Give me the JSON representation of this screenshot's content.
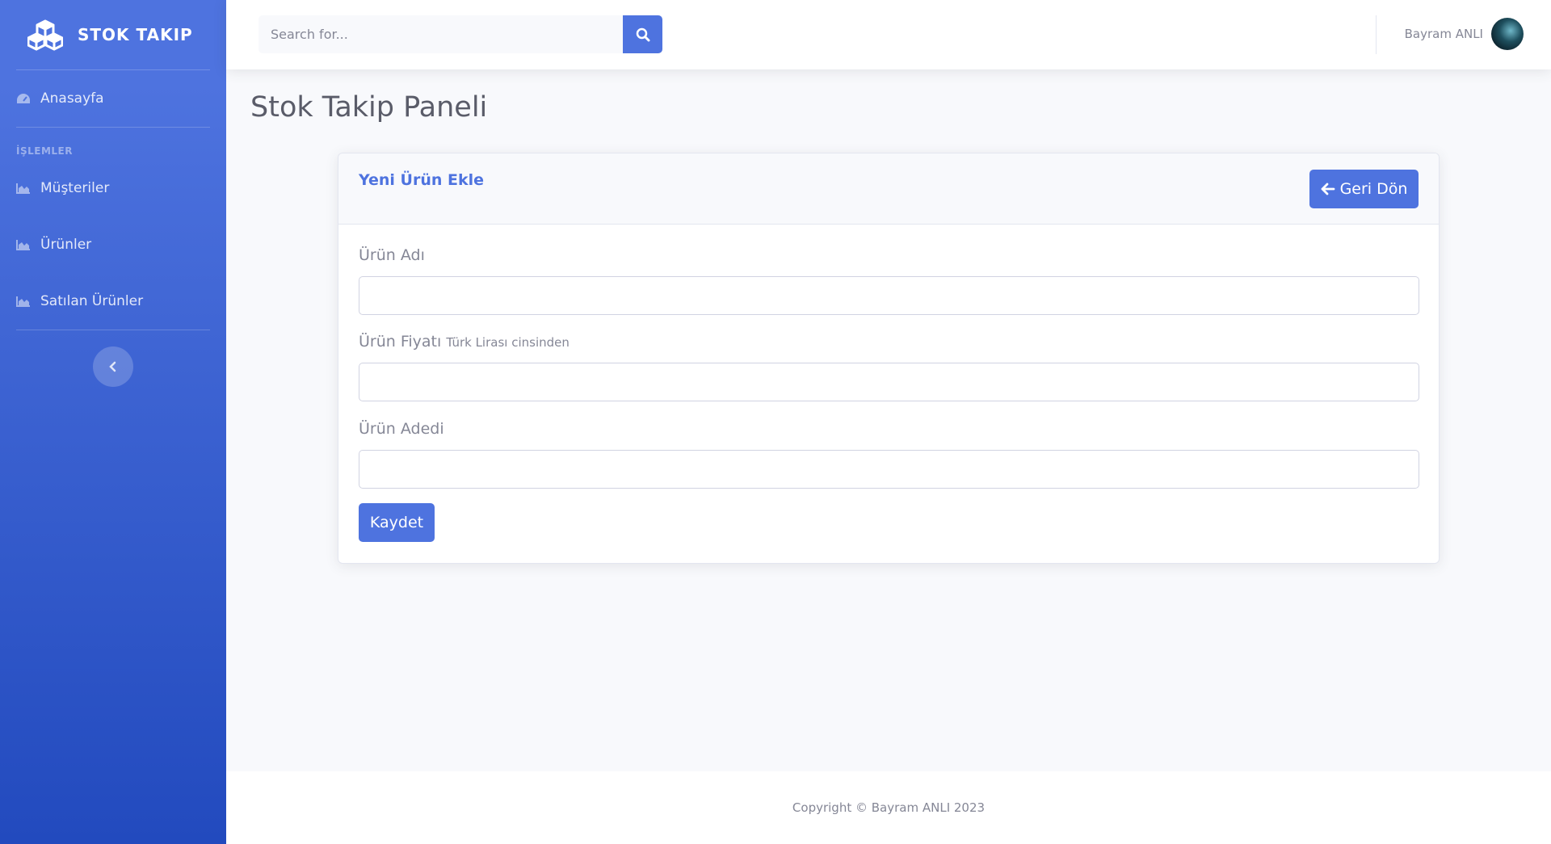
{
  "brand": {
    "name": "STOK TAKIP"
  },
  "sidebar": {
    "home_label": "Anasayfa",
    "section_heading": "İŞLEMLER",
    "items": [
      {
        "label": "Müşteriler",
        "icon": "chart-area-icon"
      },
      {
        "label": "Ürünler",
        "icon": "chart-area-icon"
      },
      {
        "label": "Satılan Ürünler",
        "icon": "chart-area-icon"
      }
    ]
  },
  "topbar": {
    "search_placeholder": "Search for...",
    "user_name": "Bayram ANLI"
  },
  "page": {
    "title": "Stok Takip Paneli"
  },
  "card": {
    "title": "Yeni Ürün Ekle",
    "back_label": "Geri Dön",
    "fields": {
      "name_label": "Ürün Adı",
      "price_label": "Ürün Fiyatı",
      "price_hint": "Türk Lirası cinsinden",
      "quantity_label": "Ürün Adedi"
    },
    "save_label": "Kaydet"
  },
  "footer": {
    "copyright": "Copyright © Bayram ANLI 2023"
  },
  "colors": {
    "primary": "#4e73df",
    "primary_dark": "#224abe",
    "text_muted": "#858796",
    "heading": "#5a5c69",
    "background": "#f8f9fc"
  }
}
